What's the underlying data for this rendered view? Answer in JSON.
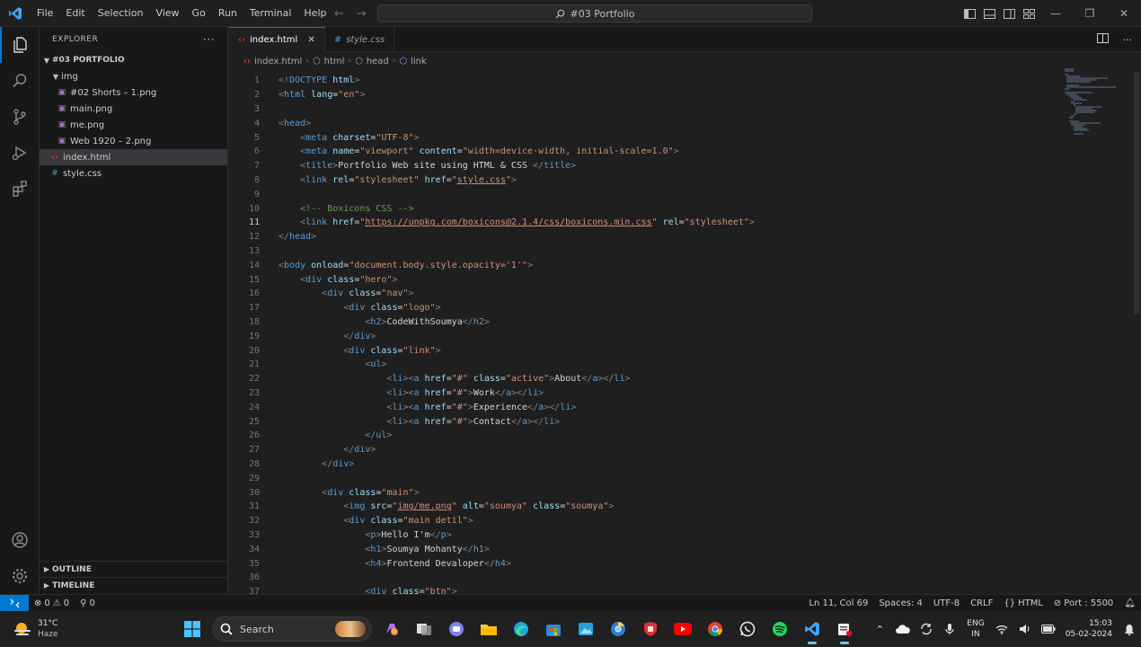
{
  "window": {
    "search_title": "#03 Portfolio",
    "menu": [
      "File",
      "Edit",
      "Selection",
      "View",
      "Go",
      "Run",
      "Terminal",
      "Help"
    ]
  },
  "sidebar": {
    "header": "EXPLORER",
    "folder": "#03 PORTFOLIO",
    "img_folder": "img",
    "img_files": [
      "#02 Shorts – 1.png",
      "main.png",
      "me.png",
      "Web 1920 – 2.png"
    ],
    "files": [
      "index.html",
      "style.css"
    ],
    "outline": "OUTLINE",
    "timeline": "TIMELINE"
  },
  "tabs": [
    {
      "label": "index.html",
      "icon": "html-icon"
    },
    {
      "label": "style.css",
      "icon": "css-icon"
    }
  ],
  "breadcrumb": [
    "index.html",
    "html",
    "head",
    "link"
  ],
  "code": {
    "current_line": 11,
    "lines": [
      {
        "n": "1",
        "indent": "",
        "parts": [
          [
            "p",
            "<!"
          ],
          [
            "t",
            "DOCTYPE"
          ],
          [
            "x",
            " "
          ],
          [
            "a",
            "html"
          ],
          [
            "p",
            ">"
          ]
        ]
      },
      {
        "n": "2",
        "indent": "",
        "parts": [
          [
            "p",
            "<"
          ],
          [
            "t",
            "html"
          ],
          [
            "x",
            " "
          ],
          [
            "a",
            "lang"
          ],
          [
            "x",
            "="
          ],
          [
            "s",
            "\"en\""
          ],
          [
            "p",
            ">"
          ]
        ]
      },
      {
        "n": "3",
        "indent": "",
        "parts": []
      },
      {
        "n": "4",
        "indent": "",
        "parts": [
          [
            "p",
            "<"
          ],
          [
            "t",
            "head"
          ],
          [
            "p",
            ">"
          ]
        ]
      },
      {
        "n": "5",
        "indent": "    ",
        "parts": [
          [
            "p",
            "<"
          ],
          [
            "t",
            "meta"
          ],
          [
            "x",
            " "
          ],
          [
            "a",
            "charset"
          ],
          [
            "x",
            "="
          ],
          [
            "s",
            "\"UTF-8\""
          ],
          [
            "p",
            ">"
          ]
        ]
      },
      {
        "n": "6",
        "indent": "    ",
        "parts": [
          [
            "p",
            "<"
          ],
          [
            "t",
            "meta"
          ],
          [
            "x",
            " "
          ],
          [
            "a",
            "name"
          ],
          [
            "x",
            "="
          ],
          [
            "s",
            "\"viewport\""
          ],
          [
            "x",
            " "
          ],
          [
            "a",
            "content"
          ],
          [
            "x",
            "="
          ],
          [
            "s",
            "\"width=device-width, initial-scale=1.0\""
          ],
          [
            "p",
            ">"
          ]
        ]
      },
      {
        "n": "7",
        "indent": "    ",
        "parts": [
          [
            "p",
            "<"
          ],
          [
            "t",
            "title"
          ],
          [
            "p",
            ">"
          ],
          [
            "x",
            "Portfolio Web site using HTML & CSS "
          ],
          [
            "p",
            "</"
          ],
          [
            "t",
            "title"
          ],
          [
            "p",
            ">"
          ]
        ]
      },
      {
        "n": "8",
        "indent": "    ",
        "parts": [
          [
            "p",
            "<"
          ],
          [
            "t",
            "link"
          ],
          [
            "x",
            " "
          ],
          [
            "a",
            "rel"
          ],
          [
            "x",
            "="
          ],
          [
            "s",
            "\"stylesheet\""
          ],
          [
            "x",
            " "
          ],
          [
            "a",
            "href"
          ],
          [
            "x",
            "="
          ],
          [
            "s",
            "\""
          ],
          [
            "l",
            "style.css"
          ],
          [
            "s",
            "\""
          ],
          [
            "p",
            ">"
          ]
        ]
      },
      {
        "n": "9",
        "indent": "",
        "parts": []
      },
      {
        "n": "10",
        "indent": "    ",
        "parts": [
          [
            "c",
            "<!-- Boxicons CSS -->"
          ]
        ]
      },
      {
        "n": "11",
        "indent": "    ",
        "parts": [
          [
            "p",
            "<"
          ],
          [
            "t",
            "link"
          ],
          [
            "x",
            " "
          ],
          [
            "a",
            "href"
          ],
          [
            "x",
            "="
          ],
          [
            "s",
            "\""
          ],
          [
            "l",
            "https://unpkg.com/boxicons@2.1.4/css/boxicons.min.css"
          ],
          [
            "s",
            "\""
          ],
          [
            "x",
            " "
          ],
          [
            "a",
            "rel"
          ],
          [
            "x",
            "="
          ],
          [
            "s",
            "\"stylesheet\""
          ],
          [
            "p",
            ">"
          ]
        ]
      },
      {
        "n": "12",
        "indent": "",
        "parts": [
          [
            "p",
            "</"
          ],
          [
            "t",
            "head"
          ],
          [
            "p",
            ">"
          ]
        ]
      },
      {
        "n": "13",
        "indent": "",
        "parts": []
      },
      {
        "n": "14",
        "indent": "",
        "parts": [
          [
            "p",
            "<"
          ],
          [
            "t",
            "body"
          ],
          [
            "x",
            " "
          ],
          [
            "a",
            "onload"
          ],
          [
            "x",
            "="
          ],
          [
            "s",
            "\"document.body.style.opacity='1'\""
          ],
          [
            "p",
            ">"
          ]
        ]
      },
      {
        "n": "15",
        "indent": "    ",
        "parts": [
          [
            "p",
            "<"
          ],
          [
            "t",
            "div"
          ],
          [
            "x",
            " "
          ],
          [
            "a",
            "class"
          ],
          [
            "x",
            "="
          ],
          [
            "s",
            "\"hero\""
          ],
          [
            "p",
            ">"
          ]
        ]
      },
      {
        "n": "16",
        "indent": "        ",
        "parts": [
          [
            "p",
            "<"
          ],
          [
            "t",
            "div"
          ],
          [
            "x",
            " "
          ],
          [
            "a",
            "class"
          ],
          [
            "x",
            "="
          ],
          [
            "s",
            "\"nav\""
          ],
          [
            "p",
            ">"
          ]
        ]
      },
      {
        "n": "17",
        "indent": "            ",
        "parts": [
          [
            "p",
            "<"
          ],
          [
            "t",
            "div"
          ],
          [
            "x",
            " "
          ],
          [
            "a",
            "class"
          ],
          [
            "x",
            "="
          ],
          [
            "s",
            "\"logo\""
          ],
          [
            "p",
            ">"
          ]
        ]
      },
      {
        "n": "18",
        "indent": "                ",
        "parts": [
          [
            "p",
            "<"
          ],
          [
            "t",
            "h2"
          ],
          [
            "p",
            ">"
          ],
          [
            "x",
            "CodeWithSoumya"
          ],
          [
            "p",
            "</"
          ],
          [
            "t",
            "h2"
          ],
          [
            "p",
            ">"
          ]
        ]
      },
      {
        "n": "19",
        "indent": "            ",
        "parts": [
          [
            "p",
            "</"
          ],
          [
            "t",
            "div"
          ],
          [
            "p",
            ">"
          ]
        ]
      },
      {
        "n": "20",
        "indent": "            ",
        "parts": [
          [
            "p",
            "<"
          ],
          [
            "t",
            "div"
          ],
          [
            "x",
            " "
          ],
          [
            "a",
            "class"
          ],
          [
            "x",
            "="
          ],
          [
            "s",
            "\"link\""
          ],
          [
            "p",
            ">"
          ]
        ]
      },
      {
        "n": "21",
        "indent": "                ",
        "parts": [
          [
            "p",
            "<"
          ],
          [
            "t",
            "ul"
          ],
          [
            "p",
            ">"
          ]
        ]
      },
      {
        "n": "22",
        "indent": "                    ",
        "parts": [
          [
            "p",
            "<"
          ],
          [
            "t",
            "li"
          ],
          [
            "p",
            "><"
          ],
          [
            "t",
            "a"
          ],
          [
            "x",
            " "
          ],
          [
            "a",
            "href"
          ],
          [
            "x",
            "="
          ],
          [
            "s",
            "\"#\""
          ],
          [
            "x",
            " "
          ],
          [
            "a",
            "class"
          ],
          [
            "x",
            "="
          ],
          [
            "s",
            "\"active\""
          ],
          [
            "p",
            ">"
          ],
          [
            "x",
            "About"
          ],
          [
            "p",
            "</"
          ],
          [
            "t",
            "a"
          ],
          [
            "p",
            "></"
          ],
          [
            "t",
            "li"
          ],
          [
            "p",
            ">"
          ]
        ]
      },
      {
        "n": "23",
        "indent": "                    ",
        "parts": [
          [
            "p",
            "<"
          ],
          [
            "t",
            "li"
          ],
          [
            "p",
            "><"
          ],
          [
            "t",
            "a"
          ],
          [
            "x",
            " "
          ],
          [
            "a",
            "href"
          ],
          [
            "x",
            "="
          ],
          [
            "s",
            "\"#\""
          ],
          [
            "p",
            ">"
          ],
          [
            "x",
            "Work"
          ],
          [
            "p",
            "</"
          ],
          [
            "t",
            "a"
          ],
          [
            "p",
            "></"
          ],
          [
            "t",
            "li"
          ],
          [
            "p",
            ">"
          ]
        ]
      },
      {
        "n": "24",
        "indent": "                    ",
        "parts": [
          [
            "p",
            "<"
          ],
          [
            "t",
            "li"
          ],
          [
            "p",
            "><"
          ],
          [
            "t",
            "a"
          ],
          [
            "x",
            " "
          ],
          [
            "a",
            "href"
          ],
          [
            "x",
            "="
          ],
          [
            "s",
            "\"#\""
          ],
          [
            "p",
            ">"
          ],
          [
            "x",
            "Experience"
          ],
          [
            "p",
            "</"
          ],
          [
            "t",
            "a"
          ],
          [
            "p",
            "></"
          ],
          [
            "t",
            "li"
          ],
          [
            "p",
            ">"
          ]
        ]
      },
      {
        "n": "25",
        "indent": "                    ",
        "parts": [
          [
            "p",
            "<"
          ],
          [
            "t",
            "li"
          ],
          [
            "p",
            "><"
          ],
          [
            "t",
            "a"
          ],
          [
            "x",
            " "
          ],
          [
            "a",
            "href"
          ],
          [
            "x",
            "="
          ],
          [
            "s",
            "\"#\""
          ],
          [
            "p",
            ">"
          ],
          [
            "x",
            "Contact"
          ],
          [
            "p",
            "</"
          ],
          [
            "t",
            "a"
          ],
          [
            "p",
            "></"
          ],
          [
            "t",
            "li"
          ],
          [
            "p",
            ">"
          ]
        ]
      },
      {
        "n": "26",
        "indent": "                ",
        "parts": [
          [
            "p",
            "</"
          ],
          [
            "t",
            "ul"
          ],
          [
            "p",
            ">"
          ]
        ]
      },
      {
        "n": "27",
        "indent": "            ",
        "parts": [
          [
            "p",
            "</"
          ],
          [
            "t",
            "div"
          ],
          [
            "p",
            ">"
          ]
        ]
      },
      {
        "n": "28",
        "indent": "        ",
        "parts": [
          [
            "p",
            "</"
          ],
          [
            "t",
            "div"
          ],
          [
            "p",
            ">"
          ]
        ]
      },
      {
        "n": "29",
        "indent": "",
        "parts": []
      },
      {
        "n": "30",
        "indent": "        ",
        "parts": [
          [
            "p",
            "<"
          ],
          [
            "t",
            "div"
          ],
          [
            "x",
            " "
          ],
          [
            "a",
            "class"
          ],
          [
            "x",
            "="
          ],
          [
            "s",
            "\"main\""
          ],
          [
            "p",
            ">"
          ]
        ]
      },
      {
        "n": "31",
        "indent": "            ",
        "parts": [
          [
            "p",
            "<"
          ],
          [
            "t",
            "img"
          ],
          [
            "x",
            " "
          ],
          [
            "a",
            "src"
          ],
          [
            "x",
            "="
          ],
          [
            "s",
            "\""
          ],
          [
            "l",
            "img/me.png"
          ],
          [
            "s",
            "\""
          ],
          [
            "x",
            " "
          ],
          [
            "a",
            "alt"
          ],
          [
            "x",
            "="
          ],
          [
            "s",
            "\"soumya\""
          ],
          [
            "x",
            " "
          ],
          [
            "a",
            "class"
          ],
          [
            "x",
            "="
          ],
          [
            "s",
            "\"soumya\""
          ],
          [
            "p",
            ">"
          ]
        ]
      },
      {
        "n": "32",
        "indent": "            ",
        "parts": [
          [
            "p",
            "<"
          ],
          [
            "t",
            "div"
          ],
          [
            "x",
            " "
          ],
          [
            "a",
            "class"
          ],
          [
            "x",
            "="
          ],
          [
            "s",
            "\"main detil\""
          ],
          [
            "p",
            ">"
          ]
        ]
      },
      {
        "n": "33",
        "indent": "                ",
        "parts": [
          [
            "p",
            "<"
          ],
          [
            "t",
            "p"
          ],
          [
            "p",
            ">"
          ],
          [
            "x",
            "Hello I'm"
          ],
          [
            "p",
            "</"
          ],
          [
            "t",
            "p"
          ],
          [
            "p",
            ">"
          ]
        ]
      },
      {
        "n": "34",
        "indent": "                ",
        "parts": [
          [
            "p",
            "<"
          ],
          [
            "t",
            "h1"
          ],
          [
            "p",
            ">"
          ],
          [
            "x",
            "Soumya Mohanty"
          ],
          [
            "p",
            "</"
          ],
          [
            "t",
            "h1"
          ],
          [
            "p",
            ">"
          ]
        ]
      },
      {
        "n": "35",
        "indent": "                ",
        "parts": [
          [
            "p",
            "<"
          ],
          [
            "t",
            "h4"
          ],
          [
            "p",
            ">"
          ],
          [
            "x",
            "Frontend Devaloper"
          ],
          [
            "p",
            "</"
          ],
          [
            "t",
            "h4"
          ],
          [
            "p",
            ">"
          ]
        ]
      },
      {
        "n": "36",
        "indent": "",
        "parts": []
      },
      {
        "n": "37",
        "indent": "                ",
        "parts": [
          [
            "p",
            "<"
          ],
          [
            "t",
            "div"
          ],
          [
            "x",
            " "
          ],
          [
            "a",
            "class"
          ],
          [
            "x",
            "="
          ],
          [
            "s",
            "\"btn\""
          ],
          [
            "p",
            ">"
          ]
        ]
      }
    ]
  },
  "status": {
    "errors": "0",
    "warnings": "0",
    "ports": "0",
    "cursor": "Ln 11, Col 69",
    "spaces": "Spaces: 4",
    "encoding": "UTF-8",
    "eol": "CRLF",
    "language": "HTML",
    "port": "Port : 5500"
  },
  "taskbar": {
    "temp": "31°C",
    "weather": "Haze",
    "search_placeholder": "Search",
    "lang_top": "ENG",
    "lang_bottom": "IN",
    "time": "15:03",
    "date": "05-02-2024"
  },
  "colors": {
    "accent": "#0078d4",
    "tag": "#569cd6",
    "attr": "#9cdcfe",
    "string": "#ce9178"
  }
}
